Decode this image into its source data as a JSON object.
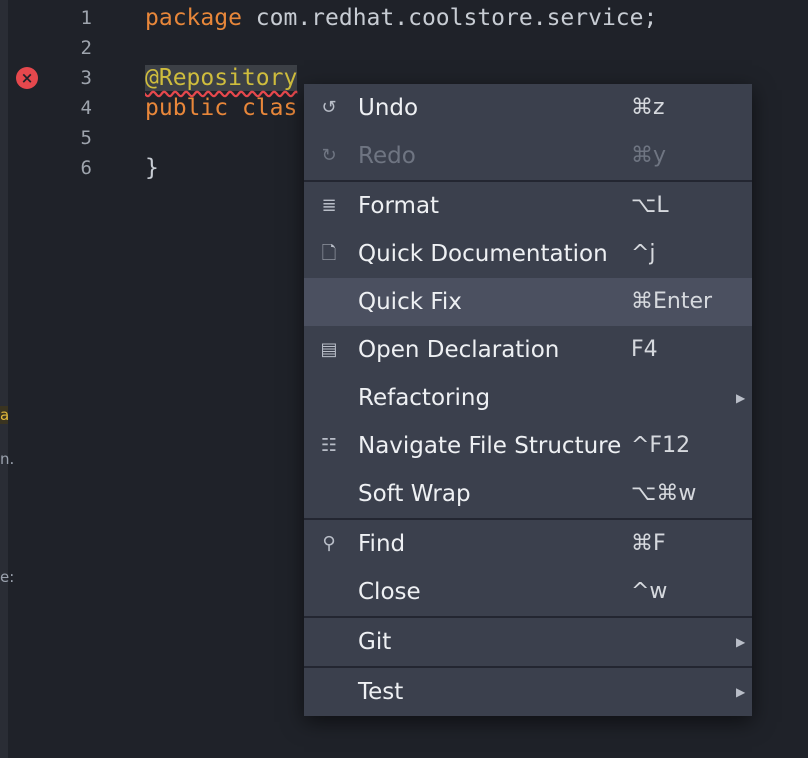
{
  "editor": {
    "lines": [
      {
        "num": "1",
        "parts": [
          {
            "t": "package",
            "c": "kw"
          },
          {
            "t": " com.redhat.coolstore.service;",
            "c": "plain"
          }
        ]
      },
      {
        "num": "2",
        "parts": []
      },
      {
        "num": "3",
        "parts": [
          {
            "t": "@Repository",
            "c": "anno"
          }
        ]
      },
      {
        "num": "4",
        "parts": [
          {
            "t": "public",
            "c": "kw"
          },
          {
            "t": " ",
            "c": "plain"
          },
          {
            "t": "clas",
            "c": "kw"
          }
        ]
      },
      {
        "num": "5",
        "parts": []
      },
      {
        "num": "6",
        "parts": [
          {
            "t": "}",
            "c": "plain"
          }
        ]
      }
    ],
    "error_marker": "×",
    "left_fragments": [
      "a",
      "n.",
      "e:"
    ]
  },
  "context_menu": {
    "items": [
      {
        "label": "Undo",
        "shortcut": "⌘z",
        "icon": "undo-icon",
        "glyph": "↺"
      },
      {
        "label": "Redo",
        "shortcut": "⌘y",
        "icon": "redo-icon",
        "glyph": "↻",
        "disabled": true
      },
      {
        "label": "Format",
        "shortcut": "⌥L",
        "icon": "format-icon",
        "glyph": "≣"
      },
      {
        "label": "Quick Documentation",
        "shortcut": "^j",
        "icon": "document-icon",
        "glyph": "🗋"
      },
      {
        "label": "Quick Fix",
        "shortcut": "⌘Enter",
        "active": true
      },
      {
        "label": "Open Declaration",
        "shortcut": "F4",
        "icon": "declaration-icon",
        "glyph": "▤"
      },
      {
        "label": "Refactoring",
        "shortcut": "",
        "submenu": true
      },
      {
        "label": "Navigate File Structure",
        "shortcut": "^F12",
        "icon": "structure-list-icon",
        "glyph": "☷"
      },
      {
        "label": "Soft Wrap",
        "shortcut": "⌥⌘w"
      },
      {
        "label": "Find",
        "shortcut": "⌘F",
        "icon": "search-icon",
        "glyph": "⚲"
      },
      {
        "label": "Close",
        "shortcut": "^w"
      },
      {
        "label": "Git",
        "shortcut": "",
        "submenu": true
      },
      {
        "label": "Test",
        "shortcut": "",
        "submenu": true
      }
    ],
    "submenu_arrow": "▶"
  }
}
